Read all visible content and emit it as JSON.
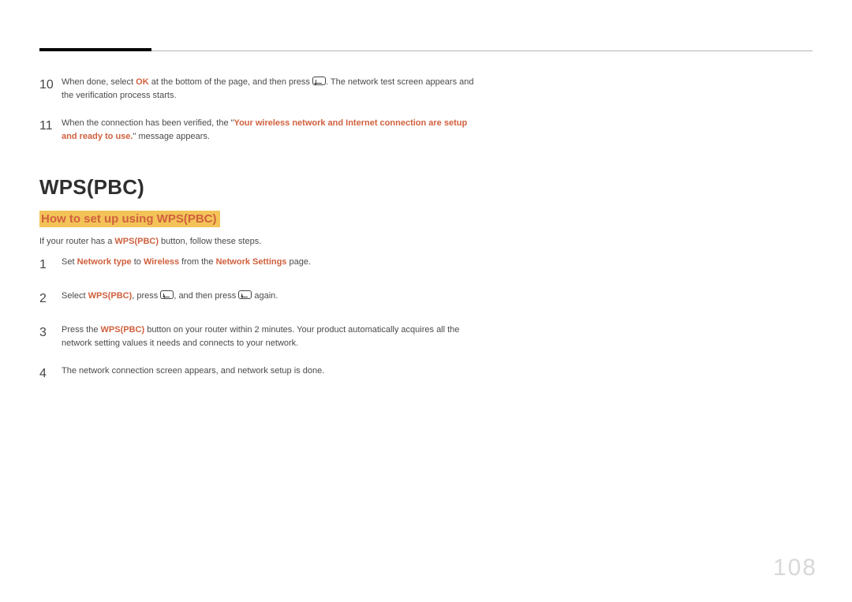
{
  "pageNumber": "108",
  "topSteps": [
    {
      "num": "10",
      "segments": [
        {
          "t": "When done, select "
        },
        {
          "t": "OK",
          "cls": "strong-red"
        },
        {
          "t": " at the bottom of the page, and then press "
        },
        {
          "icon": "enter"
        },
        {
          "t": ". The network test screen appears and the verification process starts."
        }
      ]
    },
    {
      "num": "11",
      "segments": [
        {
          "t": "When the connection has been verified, the \""
        },
        {
          "t": "Your wireless network and Internet connection are setup and ready to use.",
          "cls": "strong-red"
        },
        {
          "t": "\" message appears."
        }
      ]
    }
  ],
  "sectionTitle": "WPS(PBC)",
  "subsectionTitle": "How to set up using WPS(PBC)",
  "intro": {
    "segments": [
      {
        "t": "If your router has a "
      },
      {
        "t": "WPS(PBC)",
        "cls": "strong-red"
      },
      {
        "t": " button, follow these steps."
      }
    ]
  },
  "steps": [
    {
      "num": "1",
      "segments": [
        {
          "t": "Set "
        },
        {
          "t": "Network type",
          "cls": "strong-red"
        },
        {
          "t": " to "
        },
        {
          "t": "Wireless",
          "cls": "strong-red"
        },
        {
          "t": " from the "
        },
        {
          "t": "Network Settings",
          "cls": "strong-red"
        },
        {
          "t": " page."
        }
      ]
    },
    {
      "num": "2",
      "segments": [
        {
          "t": "Select "
        },
        {
          "t": "WPS(PBC)",
          "cls": "strong-red"
        },
        {
          "t": ", press "
        },
        {
          "icon": "enter"
        },
        {
          "t": ", and then press "
        },
        {
          "icon": "enter"
        },
        {
          "t": " again."
        }
      ]
    },
    {
      "num": "3",
      "segments": [
        {
          "t": "Press the "
        },
        {
          "t": "WPS(PBC)",
          "cls": "strong-red"
        },
        {
          "t": " button on your router within 2 minutes. Your product automatically acquires all the network setting values it needs and connects to your network."
        }
      ]
    },
    {
      "num": "4",
      "segments": [
        {
          "t": "The network connection screen appears, and network setup is done."
        }
      ]
    }
  ]
}
